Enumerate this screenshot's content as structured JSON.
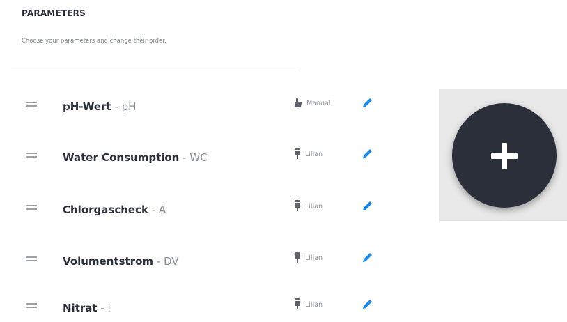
{
  "header": {
    "title": "PARAMETERS",
    "subtitle": "Choose your parameters and change their order."
  },
  "parameters": [
    {
      "name": "pH-Wert",
      "code": "pH",
      "source": "Manual",
      "source_icon": "hand-icon"
    },
    {
      "name": "Water Consumption",
      "code": "WC",
      "source": "Lilian",
      "source_icon": "sensor-icon"
    },
    {
      "name": "Chlorgascheck",
      "code": "A",
      "source": "Lilian",
      "source_icon": "sensor-icon"
    },
    {
      "name": "Volumentstrom",
      "code": "DV",
      "source": "Lilian",
      "source_icon": "sensor-icon"
    },
    {
      "name": "Nitrat",
      "code": "i",
      "source": "Lilian",
      "source_icon": "sensor-icon"
    }
  ],
  "separator": " - ",
  "colors": {
    "text_dark": "#2b2f3a",
    "accent_edit": "#1e88e5",
    "fab_bg": "#2b2f3a"
  },
  "fab": {
    "icon": "plus-icon"
  }
}
